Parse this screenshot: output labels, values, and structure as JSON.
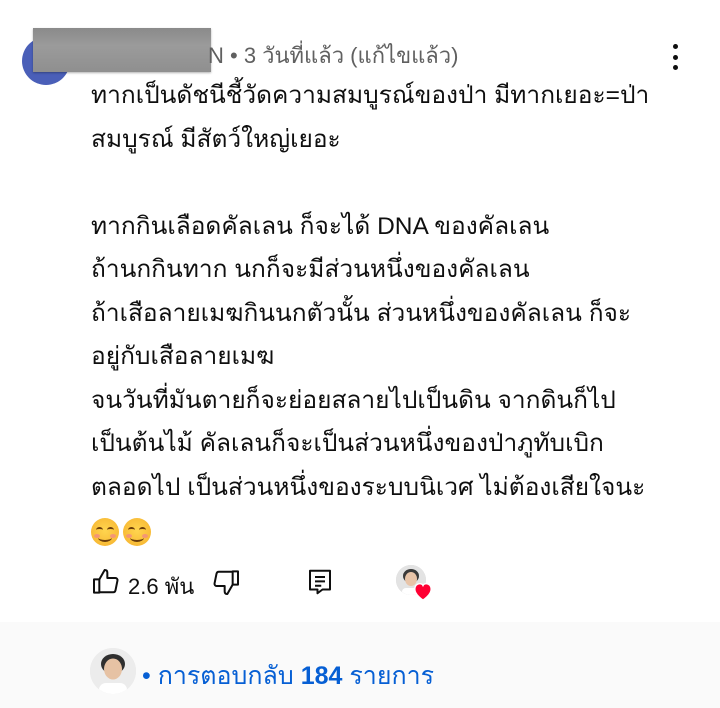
{
  "comment": {
    "meta_visible": "N • 3 วันที่แล้ว (แก้ไขแล้ว)",
    "lines": [
      "ทากเป็นดัชนีชี้วัดความสมบูรณ์ของป่า มีทากเยอะ=ป่า",
      "สมบูรณ์ มีสัตว์ใหญ่เยอะ",
      "",
      "ทากกินเลือดคัลเลน ก็จะได้ DNA ของคัลเลน",
      "ถ้านกกินทาก  นกก็จะมีส่วนหนึ่งของคัลเลน",
      "ถ้าเสือลายเมฆกินนกตัวนั้น ส่วนหนึ่งของคัลเลน ก็จะ",
      "อยู่กับเสือลายเมฆ",
      "จนวันที่มันตายก็จะย่อยสลายไปเป็นดิน  จากดินก็ไป",
      "เป็นต้นไม้  คัลเลนก็จะเป็นส่วนหนึ่งของป่าภูทับเบิก",
      "ตลอดไป เป็นส่วนหนึ่งของระบบนิเวศ  ไม่ต้องเสียใจนะ"
    ],
    "emoji": [
      "smiling-face-icon",
      "smiling-face-icon"
    ]
  },
  "actions": {
    "like_count": "2.6 พัน",
    "like_icon": "thumbs-up-icon",
    "dislike_icon": "thumbs-down-icon",
    "reply_icon": "reply-icon",
    "hearted_icon": "creator-heart-icon"
  },
  "replies": {
    "prefix": "• การตอบกลับ ",
    "count": "184",
    "suffix": " รายการ"
  },
  "colors": {
    "link_blue": "#065fd4",
    "meta_gray": "#606060",
    "heart_red": "#ff0033",
    "avatar_blue": "#4a5fb8"
  }
}
